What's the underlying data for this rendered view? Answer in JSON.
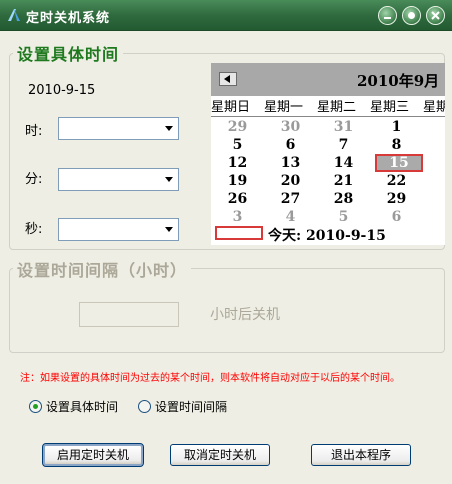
{
  "window": {
    "title": "定时关机系统",
    "minimize_label": "minimize",
    "restore_label": "restore",
    "close_label": "close"
  },
  "specific_time": {
    "group_title": "设置具体时间",
    "date_text": "2010-9-15",
    "hour_label": "时:",
    "minute_label": "分:",
    "second_label": "秒:",
    "hour_value": "",
    "minute_value": "",
    "second_value": ""
  },
  "calendar": {
    "month_title": "2010年9月",
    "weekdays": [
      "星期日",
      "星期一",
      "星期二",
      "星期三",
      "星期四"
    ],
    "rows": [
      [
        {
          "d": "29",
          "other": true
        },
        {
          "d": "30",
          "other": true
        },
        {
          "d": "31",
          "other": true
        },
        {
          "d": "1"
        },
        {
          "d": ""
        }
      ],
      [
        {
          "d": "5"
        },
        {
          "d": "6"
        },
        {
          "d": "7"
        },
        {
          "d": "8"
        },
        {
          "d": ""
        }
      ],
      [
        {
          "d": "12"
        },
        {
          "d": "13"
        },
        {
          "d": "14"
        },
        {
          "d": "15",
          "selected": true
        },
        {
          "d": "1"
        }
      ],
      [
        {
          "d": "19"
        },
        {
          "d": "20"
        },
        {
          "d": "21"
        },
        {
          "d": "22"
        },
        {
          "d": "2"
        }
      ],
      [
        {
          "d": "26"
        },
        {
          "d": "27"
        },
        {
          "d": "28"
        },
        {
          "d": "29"
        },
        {
          "d": "3"
        }
      ],
      [
        {
          "d": "3",
          "other": true
        },
        {
          "d": "4",
          "other": true
        },
        {
          "d": "5",
          "other": true
        },
        {
          "d": "6",
          "other": true
        },
        {
          "d": ""
        }
      ]
    ],
    "today_text": "今天: 2010-9-15"
  },
  "interval": {
    "group_title": "设置时间间隔（小时）",
    "suffix_label": "小时后关机",
    "value": ""
  },
  "note": "注：如果设置的具体时间为过去的某个时间，则本软件将自动对应于以后的某个时间。",
  "mode": {
    "option_specific": "设置具体时间",
    "option_interval": "设置时间间隔",
    "selected": "specific"
  },
  "buttons": {
    "enable": "启用定时关机",
    "cancel": "取消定时关机",
    "exit": "退出本程序"
  },
  "colors": {
    "titlebar": "#2f6b3e",
    "window_bg": "#eeeee4",
    "group_title": "#1f7a1f",
    "note": "#ff0000",
    "selected_day_border": "#d83a3a"
  }
}
